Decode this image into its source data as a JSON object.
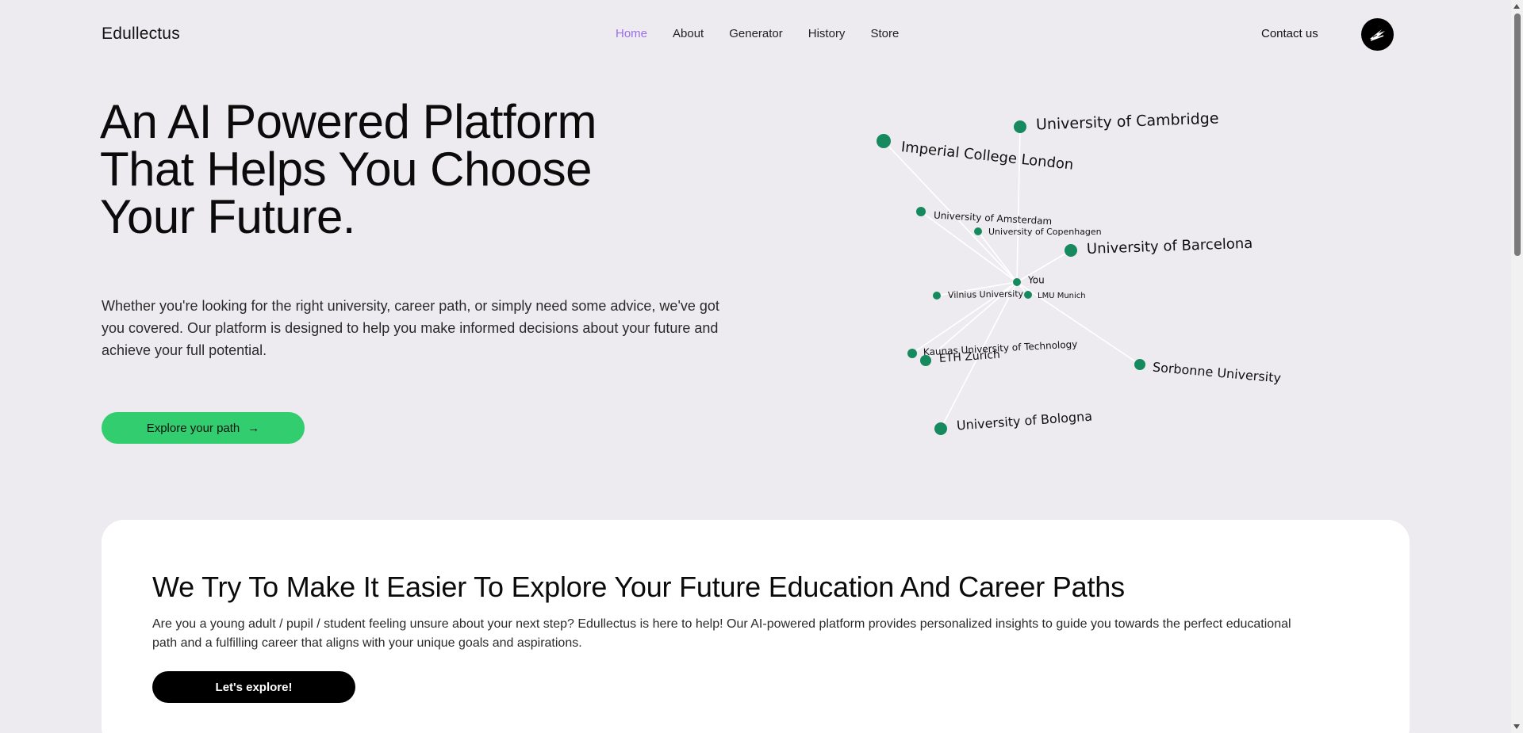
{
  "header": {
    "logo": "Edullectus",
    "nav": [
      {
        "label": "Home",
        "active": true
      },
      {
        "label": "About",
        "active": false
      },
      {
        "label": "Generator",
        "active": false
      },
      {
        "label": "History",
        "active": false
      },
      {
        "label": "Store",
        "active": false
      }
    ],
    "contact": "Contact us"
  },
  "hero": {
    "title_lines": [
      "An AI Powered Platform",
      "That Helps You Choose",
      "Your Future."
    ],
    "description": "Whether you're looking for the right university, career path, or simply need some advice, we've got you covered. Our platform is designed to help you make informed decisions about your future and achieve your full potential.",
    "cta": "Explore your path",
    "cta_arrow": "→"
  },
  "graph": {
    "center_label": "You",
    "node_color": "#168a5e",
    "edge_color": "#ffffff",
    "nodes": [
      {
        "label": "University of Cambridge"
      },
      {
        "label": "Imperial College London"
      },
      {
        "label": "University of Amsterdam"
      },
      {
        "label": "University of Copenhagen"
      },
      {
        "label": "University of Barcelona"
      },
      {
        "label": "Vilnius University"
      },
      {
        "label": "LMU Munich"
      },
      {
        "label": "Kaunas University of Technology"
      },
      {
        "label": "ETH Zurich"
      },
      {
        "label": "Sorbonne University"
      },
      {
        "label": "University of Bologna"
      }
    ]
  },
  "section": {
    "title": "We Try To Make It Easier To Explore Your Future Education And Career Paths",
    "description": "Are you a young adult / pupil / student feeling unsure about your next step? Edullectus is here to help! Our AI-powered platform provides personalized insights to guide you towards the perfect educational path and a fulfilling career that aligns with your unique goals and aspirations.",
    "cta": "Let's explore!"
  },
  "colors": {
    "background": "#edebf0",
    "accent": "#9b6ee8",
    "cta_green": "#32cd6f"
  }
}
